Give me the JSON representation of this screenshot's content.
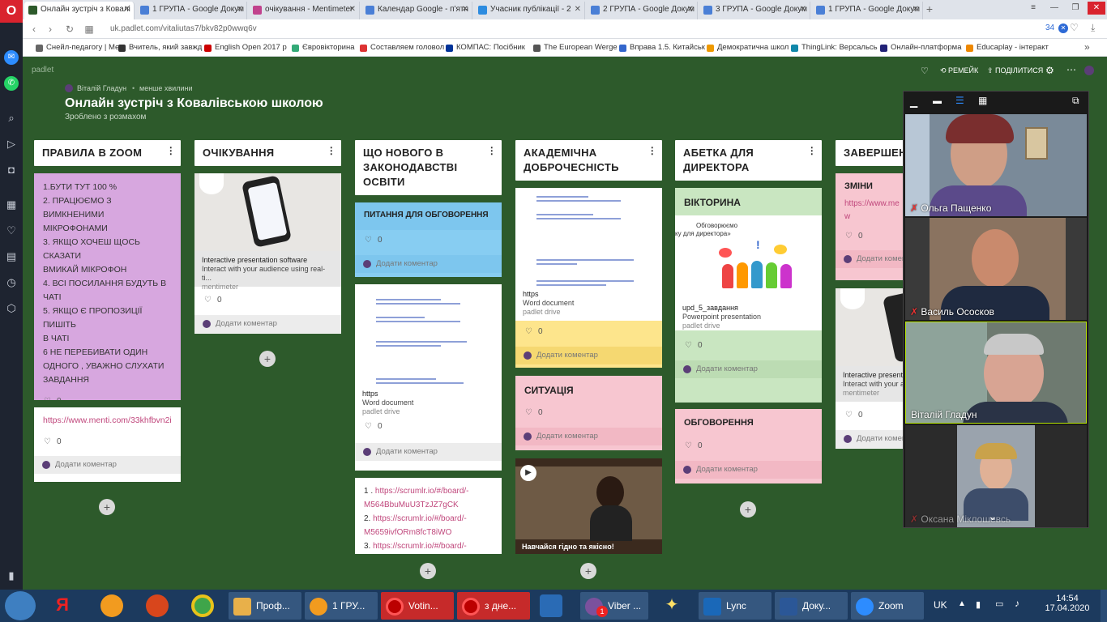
{
  "browser": {
    "tabs": [
      {
        "label": "Онлайн зустріч з Ковалі",
        "color": "#2d5a2b"
      },
      {
        "label": "1 ГРУПА - Google Докум",
        "color": "#4a7fd6"
      },
      {
        "label": "очікування - Mentimeter",
        "color": "#c1428d"
      },
      {
        "label": "Календар Google - п'ятн",
        "color": "#4a7fd6"
      },
      {
        "label": "Учасник публікації - 2",
        "color": "#2d8ce0"
      },
      {
        "label": "2 ГРУПА - Google Докум",
        "color": "#4a7fd6"
      },
      {
        "label": "3 ГРУПА - Google Докум",
        "color": "#4a7fd6"
      },
      {
        "label": "1 ГРУПА - Google Докум",
        "color": "#4a7fd6"
      }
    ],
    "url": "uk.padlet.com/vitaliutas7/bkv82p0wwq6v",
    "counter": "34",
    "bookmarks": [
      {
        "label": "Снейл-педагогу | Ме",
        "color": "#666"
      },
      {
        "label": "Вчитель, який завжд",
        "color": "#333"
      },
      {
        "label": "English Open 2017 р",
        "color": "#c00"
      },
      {
        "label": "Євровікторина",
        "color": "#3a7"
      },
      {
        "label": "Составляем головол",
        "color": "#d33"
      },
      {
        "label": "КОМПАС: Посібник",
        "color": "#039"
      },
      {
        "label": "The European Werge",
        "color": "#555"
      },
      {
        "label": "Вправа 1.5. Китайськ",
        "color": "#36c"
      },
      {
        "label": "Демократична школ",
        "color": "#e90"
      },
      {
        "label": "ThingLink: Версальсь",
        "color": "#18a"
      },
      {
        "label": "Онлайн-платформа",
        "color": "#227"
      },
      {
        "label": "Educaplay - інтеракт",
        "color": "#e80"
      }
    ]
  },
  "padlet": {
    "brand": "padlet",
    "author": "Віталій Гладун",
    "time": "менше хвилини",
    "title": "Онлайн зустріч з Ковалівською школою",
    "subtitle": "Зроблено з розмахом",
    "remake": "РЕМЕЙК",
    "share": "ПОДІЛИТИСЯ",
    "add_comment": "Додати коментар",
    "columns": [
      {
        "title": "ПРАВИЛА В ZOOM",
        "rules_lines": [
          "1.БУТИ ТУТ 100 %",
          "2. ПРАЦЮЄМО З ВИМКНЕНИМИ",
          "МІКРОФОНАМИ",
          "3. ЯКЩО ХОЧЕШ ЩОСЬ СКАЗАТИ",
          "ВМИКАЙ МІКРОФОН",
          "4. ВСІ ПОСИЛАННЯ БУДУТЬ В",
          "ЧАТІ",
          "5. ЯКЩО Є ПРОПОЗИЦІЇ ПИШІТЬ",
          "В ЧАТІ",
          "6 НЕ ПЕРЕБИВАТИ ОДИН",
          "ОДНОГО , УВАЖНО СЛУХАТИ",
          "ЗАВДАННЯ"
        ],
        "rules_likes": "0",
        "link": "https://www.menti.com/33khfbvn2i",
        "link_likes": "0"
      },
      {
        "title": "ОЧІКУВАННЯ",
        "card_title": "Interactive presentation software",
        "card_desc": "Interact with your audience using real-ti...",
        "card_source": "mentimeter",
        "likes": "0"
      },
      {
        "title": "ЩО НОВОГО В ЗАКОНОДАВСТВІ ОСВІТИ",
        "q_title": "ПИТАННЯ ДЛЯ ОБГОВОРЕННЯ",
        "q_likes": "0",
        "doc_title": "https",
        "doc_type": "Word document",
        "doc_source": "padlet drive",
        "doc_likes": "0",
        "links": [
          {
            "prefix": "1 . ",
            "lines": [
              "https://scrumlr.io/#/board/-",
              "M564BbuMuU3TzJZ7gCK"
            ]
          },
          {
            "prefix": "2. ",
            "lines": [
              "https://scrumlr.io/#/board/-",
              "M5659ivfORm8fcT8iWO"
            ]
          },
          {
            "prefix": "3. ",
            "lines": [
              "https://scrumlr.io/#/board/-"
            ]
          }
        ]
      },
      {
        "title": "АКАДЕМІЧНА ДОБРОЧЕСНІСТЬ",
        "doc_title": "https",
        "doc_type": "Word document",
        "doc_source": "padlet drive",
        "doc_likes": "0",
        "sit_title": "СИТУАЦІЯ",
        "sit_likes": "0",
        "video_caption": "Навчайся гідно та якісно!"
      },
      {
        "title": "АБЕТКА ДЛЯ ДИРЕКТОРА",
        "quiz_title": "ВІКТОРИНА",
        "img_text1": "Обговорюємо",
        "img_text2": "ку для директора»",
        "ppt_title": "upd_5_завдання",
        "ppt_type": "Powerpoint presentation",
        "ppt_source": "padlet drive",
        "quiz_likes": "0",
        "disc_title": "ОБГОВОРЕННЯ",
        "disc_likes": "0"
      },
      {
        "title": "ЗАВЕРШЕН",
        "ch_title": "ЗМІНИ",
        "ch_link1": "https://www.me",
        "ch_link2": "w",
        "ch_likes": "0",
        "m_title": "Interactive present",
        "m_desc": "Interact with your a",
        "m_source": "mentimeter",
        "m_likes": "0"
      }
    ]
  },
  "zoom": {
    "participants": [
      {
        "name": "Ольга Пащенко",
        "muted": true
      },
      {
        "name": "Василь Ососков",
        "muted": true
      },
      {
        "name": "Віталій Гладун",
        "muted": false
      },
      {
        "name": "Оксана Міклошевсь",
        "muted": true
      }
    ]
  },
  "taskbar": {
    "items": [
      {
        "label": "Проф...",
        "color": "#e8b04a"
      },
      {
        "label": "1 ГРУ...",
        "color": "#f29b1f"
      },
      {
        "label": "Votin...",
        "color": "#d12"
      },
      {
        "label": "з дне...",
        "color": "#d12"
      },
      {
        "label": "Viber ...",
        "color": "#7b519d"
      },
      {
        "label": "Lync",
        "color": "#1a68b8"
      },
      {
        "label": "Доку...",
        "color": "#2b5797"
      },
      {
        "label": "Zoom",
        "color": "#2d8cff"
      }
    ],
    "lang": "UK",
    "time": "14:54",
    "date": "17.04.2020",
    "viber_badge": "1"
  },
  "colors": {
    "bg": "#2d5a2b",
    "pink": "#f7c6d0",
    "purple": "#d7a7df",
    "blue": "#87cdf2",
    "yellow": "#fde58c",
    "green": "#c9e6c1"
  }
}
